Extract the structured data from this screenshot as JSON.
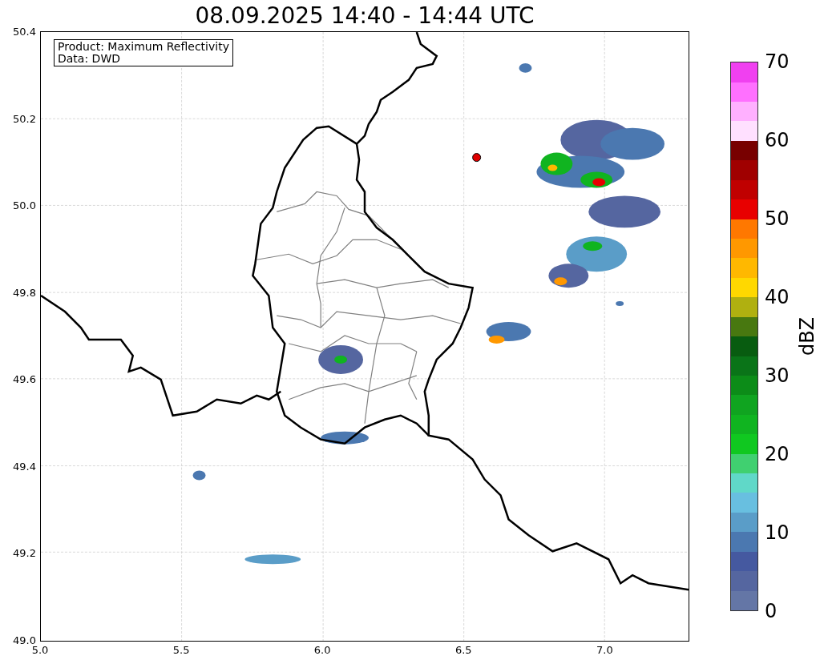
{
  "title": "08.09.2025 14:40 - 14:44 UTC",
  "map": {
    "annotation": [
      "Product: Maximum Reflectivity",
      "Data: DWD"
    ],
    "xticks": [
      "5.0",
      "5.5",
      "6.0",
      "6.5",
      "7.0"
    ],
    "yticks": [
      "50.4",
      "50.2",
      "50.0",
      "49.8",
      "49.6",
      "49.4",
      "49.2",
      "49.0"
    ]
  },
  "colorbar": {
    "label": "dBZ",
    "ticks": [
      "70",
      "60",
      "50",
      "40",
      "30",
      "20",
      "10",
      "0"
    ],
    "segments": [
      {
        "color": "#6476a6"
      },
      {
        "color": "#5566a0"
      },
      {
        "color": "#4559a0"
      },
      {
        "color": "#4b78b0"
      },
      {
        "color": "#5a9dc8"
      },
      {
        "color": "#68bfe0"
      },
      {
        "color": "#60d8c8"
      },
      {
        "color": "#40d070"
      },
      {
        "color": "#10c820"
      },
      {
        "color": "#10b420"
      },
      {
        "color": "#10a420"
      },
      {
        "color": "#0c8c18"
      },
      {
        "color": "#0a7418"
      },
      {
        "color": "#085c10"
      },
      {
        "color": "#487810"
      },
      {
        "color": "#b0b010"
      },
      {
        "color": "#ffd800"
      },
      {
        "color": "#ffb800"
      },
      {
        "color": "#ff9800"
      },
      {
        "color": "#ff7800"
      },
      {
        "color": "#e80000"
      },
      {
        "color": "#c00000"
      },
      {
        "color": "#a00000"
      },
      {
        "color": "#780000"
      },
      {
        "color": "#ffe0ff"
      },
      {
        "color": "#ffb0ff"
      },
      {
        "color": "#ff70ff"
      },
      {
        "color": "#f040f0"
      }
    ]
  }
}
